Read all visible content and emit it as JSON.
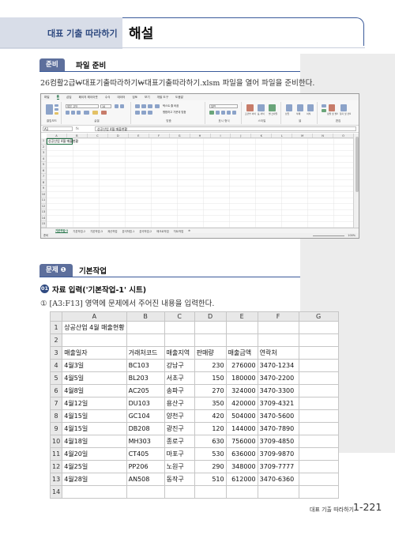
{
  "header": {
    "section_label": "대표 기출 따라하기",
    "title": "해설"
  },
  "prep": {
    "pill": "준비",
    "title": "파일 준비",
    "instruction": "26컴활2급₩대표기출따라하기₩대표기출따라하기.xlsm 파일을 열어 파일을 준비한다."
  },
  "excel": {
    "menu": [
      "파일",
      "홈",
      "삽입",
      "페이지 레이아웃",
      "수식",
      "데이터",
      "검토",
      "보기",
      "개발 도구",
      "도움말"
    ],
    "active_menu": "홈",
    "ribbon_groups": [
      "클립보드",
      "글꼴",
      "맞춤",
      "표시 형식",
      "스타일",
      "셀",
      "편집"
    ],
    "font_name": "맑은 고딕",
    "font_size": "10",
    "number_format": "일반",
    "ribbon_labels": [
      "텍스트 줄 바꿈",
      "병합하고 가운데 맞춤",
      "조건부 서식",
      "표 서식",
      "셀 스타일",
      "삽입",
      "삭제",
      "서식",
      "정렬 및 필터",
      "찾기 및 선택"
    ],
    "name_box": "A1",
    "fx": "fx",
    "formula_value": "상공산업 4월 매출현황",
    "columns": [
      "A",
      "B",
      "C",
      "D",
      "E",
      "F",
      "G",
      "H",
      "I",
      "J",
      "K",
      "L",
      "M",
      "N",
      "O"
    ],
    "rows": [
      "1",
      "2",
      "3",
      "4",
      "5",
      "6",
      "7",
      "8",
      "9",
      "10",
      "11",
      "12",
      "13",
      "14",
      "15",
      "16"
    ],
    "a1_text": "상공산업 4월 매출현황",
    "sheets": [
      "기본작업-1",
      "기본작업-2",
      "기본작업-3",
      "계산작업",
      "분석작업-1",
      "분석작업-2",
      "매크로작업",
      "차트작업"
    ],
    "active_sheet": "기본작업-1",
    "status_ready": "준비",
    "zoom": "100%"
  },
  "problem": {
    "pill": "문제 ❶",
    "title": "기본작업"
  },
  "question": {
    "num": "01",
    "title": "자료 입력('기본작업-1' 시트)",
    "step": "① [A3:F13] 영역에 문제에서 주어진 내용을 입력한다."
  },
  "table": {
    "columns": [
      "A",
      "B",
      "C",
      "D",
      "E",
      "F",
      "G"
    ],
    "rows": [
      {
        "n": "1",
        "cells": [
          "상공산업 4월 매출현황",
          "",
          "",
          "",
          "",
          "",
          ""
        ]
      },
      {
        "n": "2",
        "cells": [
          "",
          "",
          "",
          "",
          "",
          "",
          ""
        ]
      },
      {
        "n": "3",
        "cells": [
          "매출일자",
          "거래처코드",
          "매출지역",
          "판매량",
          "매출금액",
          "연락처",
          ""
        ]
      },
      {
        "n": "4",
        "cells": [
          "4월3일",
          "BC103",
          "강남구",
          "230",
          "276000",
          "3470-1234",
          ""
        ]
      },
      {
        "n": "5",
        "cells": [
          "4월5일",
          "BL203",
          "서초구",
          "150",
          "180000",
          "3470-2200",
          ""
        ]
      },
      {
        "n": "6",
        "cells": [
          "4월8일",
          "AC205",
          "송파구",
          "270",
          "324000",
          "3470-3300",
          ""
        ]
      },
      {
        "n": "7",
        "cells": [
          "4월12일",
          "DU103",
          "용산구",
          "350",
          "420000",
          "3709-4321",
          ""
        ]
      },
      {
        "n": "8",
        "cells": [
          "4월15일",
          "GC104",
          "양천구",
          "420",
          "504000",
          "3470-5600",
          ""
        ]
      },
      {
        "n": "9",
        "cells": [
          "4월15일",
          "DB208",
          "광진구",
          "120",
          "144000",
          "3470-7890",
          ""
        ]
      },
      {
        "n": "10",
        "cells": [
          "4월18일",
          "MH303",
          "종로구",
          "630",
          "756000",
          "3709-4850",
          ""
        ]
      },
      {
        "n": "11",
        "cells": [
          "4월20일",
          "CT405",
          "마포구",
          "530",
          "636000",
          "3709-9870",
          ""
        ]
      },
      {
        "n": "12",
        "cells": [
          "4월25일",
          "PP206",
          "노원구",
          "290",
          "348000",
          "3709-7777",
          ""
        ]
      },
      {
        "n": "13",
        "cells": [
          "4월28일",
          "AN508",
          "동작구",
          "510",
          "612000",
          "3470-6360",
          ""
        ]
      },
      {
        "n": "14",
        "cells": [
          "",
          "",
          "",
          "",
          "",
          "",
          ""
        ]
      }
    ]
  },
  "footer": {
    "section": "대표 기출 따라하기",
    "page": "1-221"
  }
}
